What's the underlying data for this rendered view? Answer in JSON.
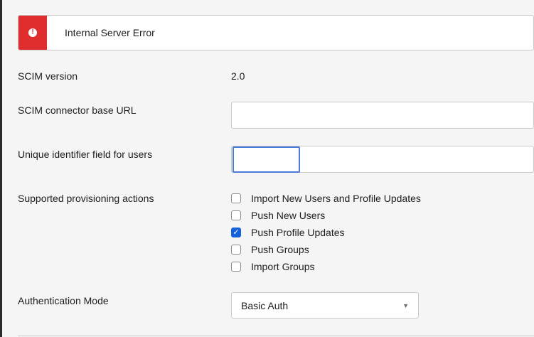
{
  "alert": {
    "message": "Internal Server Error",
    "icon": "exclamation-icon",
    "color": "#e02d2d"
  },
  "fields": {
    "scim_version": {
      "label": "SCIM version",
      "value": "2.0"
    },
    "base_url": {
      "label": "SCIM connector base URL",
      "value": ""
    },
    "unique_id": {
      "label": "Unique identifier field for users",
      "value": ""
    },
    "provisioning": {
      "label": "Supported provisioning actions",
      "options": [
        {
          "label": "Import New Users and Profile Updates",
          "checked": false
        },
        {
          "label": "Push New Users",
          "checked": false
        },
        {
          "label": "Push Profile Updates",
          "checked": true
        },
        {
          "label": "Push Groups",
          "checked": false
        },
        {
          "label": "Import Groups",
          "checked": false
        }
      ]
    },
    "auth_mode": {
      "label": "Authentication Mode",
      "selected": "Basic Auth"
    }
  },
  "colors": {
    "accent": "#1662dd",
    "error": "#e02d2d",
    "focus": "#4a7bd6"
  }
}
